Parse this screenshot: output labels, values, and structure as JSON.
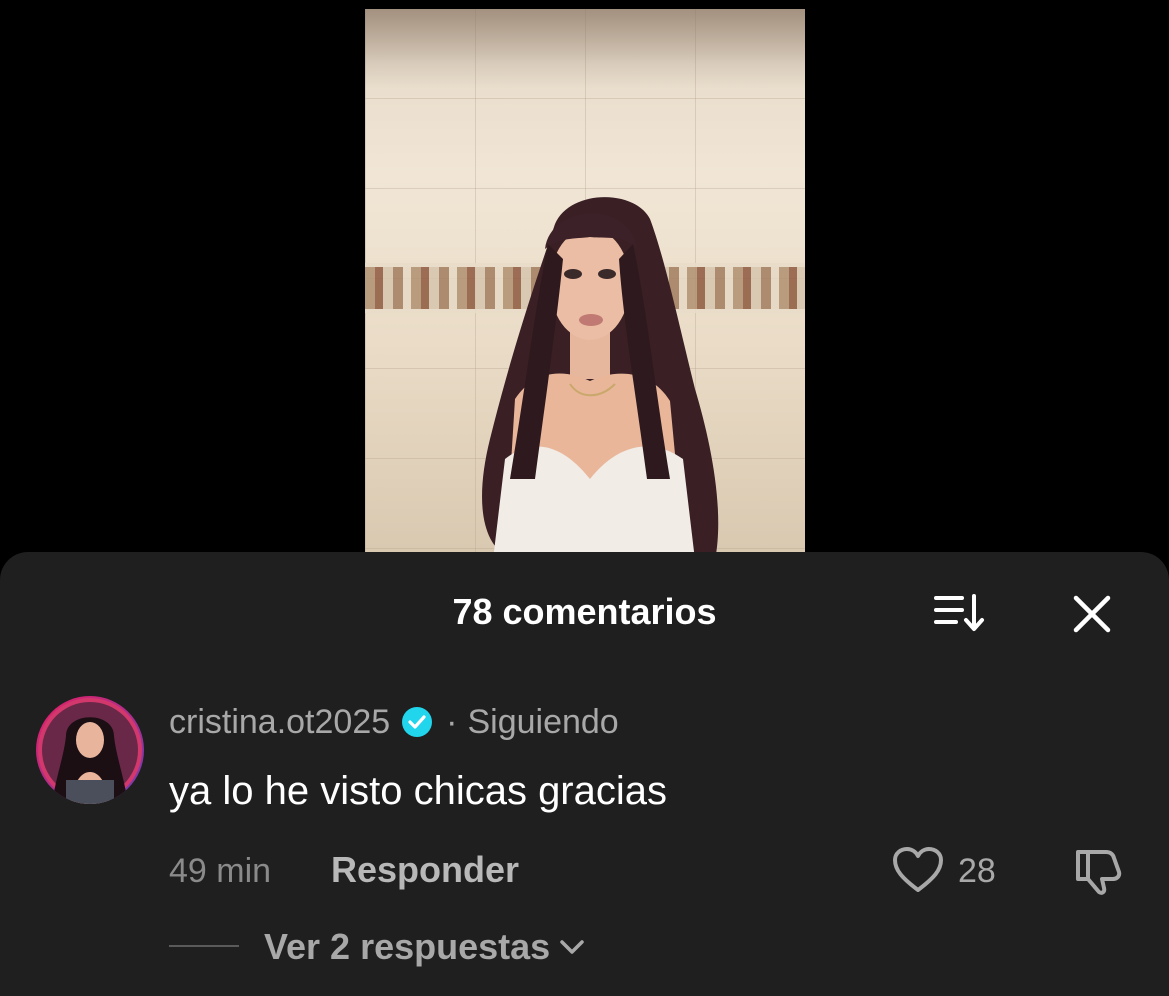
{
  "video": {
    "description_hidden": ""
  },
  "sheet": {
    "title": "78 comentarios",
    "sort_icon": "sort-icon",
    "close_icon": "close-icon"
  },
  "comment": {
    "username": "cristina.ot2025",
    "verified_icon": "verified-badge-icon",
    "separator": "·",
    "follow_status": "Siguiendo",
    "text": "ya lo he visto chicas gracias",
    "time": "49 min",
    "reply_label": "Responder",
    "like_icon": "heart-icon",
    "like_count": "28",
    "dislike_icon": "dislike-icon",
    "view_replies_label": "Ver 2 respuestas",
    "view_replies_icon": "chevron-down-icon"
  },
  "colors": {
    "sheet_bg": "#1f1f1f",
    "verified_blue": "#20d5ec",
    "text_primary": "#ffffff",
    "text_secondary": "#a8a8a8"
  }
}
